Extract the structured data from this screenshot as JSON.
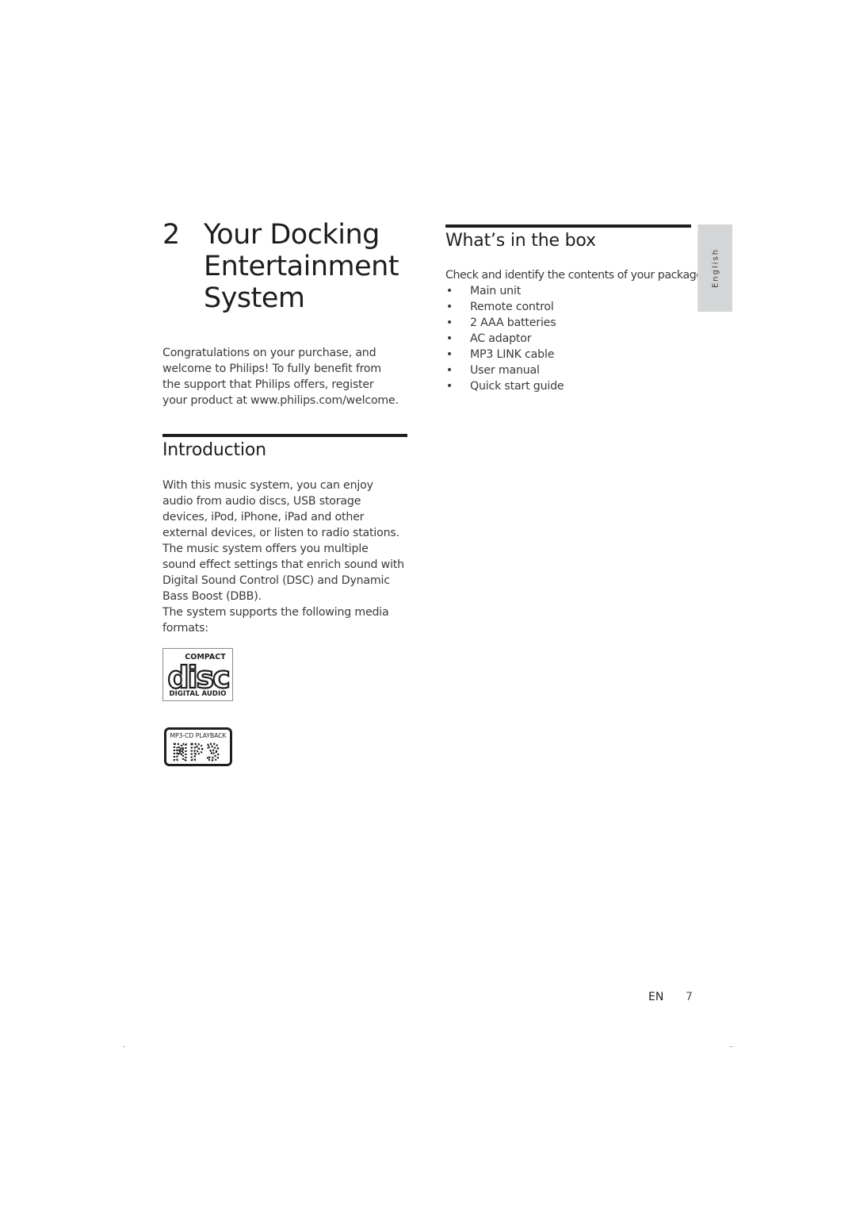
{
  "chapter": {
    "number": "2",
    "title": "Your Docking Entertainment System"
  },
  "welcome_text": "Congratulations on your purchase, and welcome to Philips! To fully benefit from the support that Philips offers, register your product at www.philips.com/welcome.",
  "introduction": {
    "heading": "Introduction",
    "paragraphs": [
      "With this music system, you can enjoy audio from audio discs, USB storage devices, iPod, iPhone, iPad and other external devices, or listen to radio stations.",
      "The music system offers you multiple sound effect settings that enrich sound with Digital Sound Control (DSC) and Dynamic Bass Boost (DBB).",
      "The system supports the following media formats:"
    ],
    "logos": {
      "cd": {
        "top": "COMPACT",
        "middle": "disc",
        "bottom": "DIGITAL AUDIO"
      },
      "mp3": {
        "top": "MP3-CD PLAYBACK",
        "middle": "MP3"
      }
    }
  },
  "whats_in_box": {
    "heading": "What’s in the box",
    "intro": "Check and identify the contents of your package:",
    "bullet": "•",
    "items": [
      "Main unit",
      "Remote control",
      "2 AAA batteries",
      "AC adaptor",
      "MP3 LINK cable",
      "User manual",
      "Quick start guide"
    ]
  },
  "language_tab": "English",
  "footer": {
    "language_code": "EN",
    "page_number": "7"
  },
  "colors": {
    "text": "#3a3a3a",
    "heading": "#1e1e1e",
    "tab_background": "#d4d5d6"
  }
}
